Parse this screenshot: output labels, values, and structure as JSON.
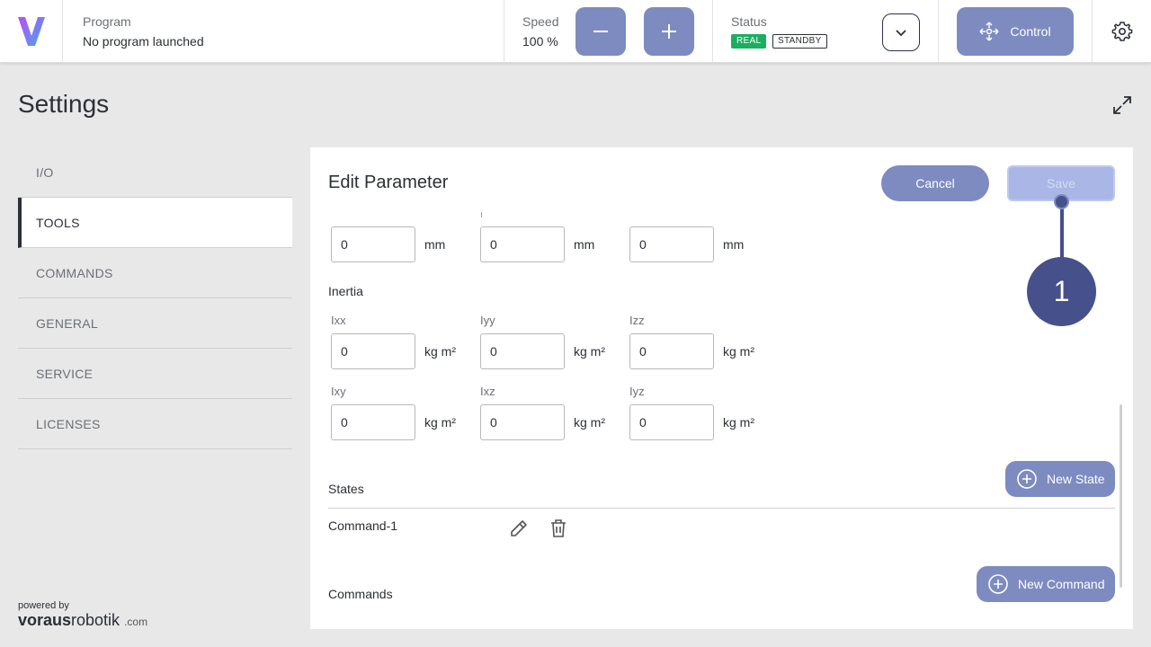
{
  "header": {
    "program_label": "Program",
    "program_value": "No program launched",
    "speed_label": "Speed",
    "speed_value": "100 %",
    "status_label": "Status",
    "status_badges": [
      "REAL",
      "STANDBY"
    ],
    "control_label": "Control"
  },
  "page": {
    "title": "Settings"
  },
  "sidebar": {
    "items": [
      {
        "label": "I/O"
      },
      {
        "label": "TOOLS"
      },
      {
        "label": "COMMANDS"
      },
      {
        "label": "GENERAL"
      },
      {
        "label": "SERVICE"
      },
      {
        "label": "LICENSES"
      }
    ],
    "active_index": 1
  },
  "footer": {
    "powered_by": "powered by",
    "brand_bold": "vorаus",
    "brand_rest": "robotik",
    "brand_suffix": ".com"
  },
  "panel": {
    "title": "Edit Parameter",
    "cancel_label": "Cancel",
    "save_label": "Save",
    "position_row": [
      {
        "value": "0",
        "unit": "mm"
      },
      {
        "value": "0",
        "unit": "mm"
      },
      {
        "value": "0",
        "unit": "mm"
      }
    ],
    "inertia_label": "Inertia",
    "inertia_row1": [
      {
        "label": "Ixx",
        "value": "0",
        "unit": "kg m²"
      },
      {
        "label": "Iyy",
        "value": "0",
        "unit": "kg m²"
      },
      {
        "label": "Izz",
        "value": "0",
        "unit": "kg m²"
      }
    ],
    "inertia_row2": [
      {
        "label": "Ixy",
        "value": "0",
        "unit": "kg m²"
      },
      {
        "label": "Ixz",
        "value": "0",
        "unit": "kg m²"
      },
      {
        "label": "Iyz",
        "value": "0",
        "unit": "kg m²"
      }
    ],
    "states_label": "States",
    "new_state_label": "New State",
    "states": [
      {
        "name": "Command-1"
      }
    ],
    "commands_label": "Commands",
    "new_command_label": "New Command"
  },
  "annotation": {
    "number": "1"
  },
  "colors": {
    "accent": "#7e8bc0",
    "accent_dark": "#46508a",
    "real_badge": "#1aae61"
  }
}
